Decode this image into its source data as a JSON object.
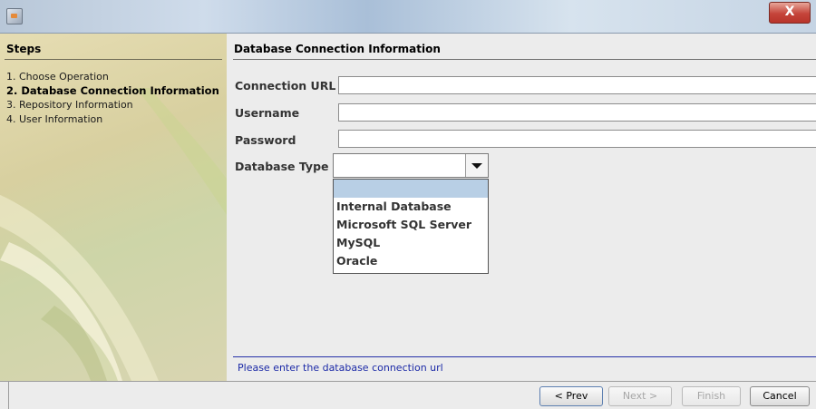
{
  "window": {
    "close_glyph": "X"
  },
  "steps": {
    "title": "Steps",
    "items": [
      {
        "label": "1. Choose Operation"
      },
      {
        "label": "2. Database Connection Information"
      },
      {
        "label": "3. Repository Information"
      },
      {
        "label": "4. User Information"
      }
    ],
    "current_index": 1
  },
  "content": {
    "title": "Database Connection Information",
    "fields": {
      "connection_url": {
        "label": "Connection URL",
        "value": ""
      },
      "username": {
        "label": "Username",
        "value": ""
      },
      "password": {
        "label": "Password",
        "value": ""
      },
      "database_type": {
        "label": "Database Type",
        "value": ""
      }
    },
    "database_type_options": [
      "",
      "Internal Database",
      "Microsoft SQL Server",
      "MySQL",
      "Oracle"
    ],
    "status_message": "Please enter the database connection url"
  },
  "buttons": {
    "prev": "< Prev",
    "next": "Next >",
    "finish": "Finish",
    "cancel": "Cancel"
  },
  "colors": {
    "status_text": "#1c2aa7",
    "popup_highlight": "#b8cfe5"
  }
}
